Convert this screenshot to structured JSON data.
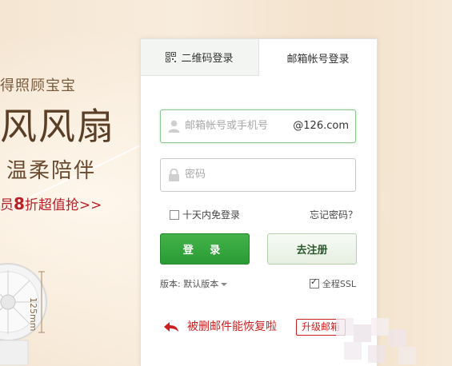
{
  "promo": {
    "line1": "得照顾宝宝",
    "line2": "风风扇",
    "line3": "温柔陪伴",
    "line4_pre": "员",
    "line4_hl": "8",
    "line4_post": "折超值抢>>",
    "dimension": "125mm"
  },
  "tabs": {
    "qr_label": "二维码登录",
    "email_label": "邮箱帐号登录"
  },
  "form": {
    "account_placeholder": "邮箱帐号或手机号",
    "domain_suffix": "@126.com",
    "password_placeholder": "密码",
    "remember_label": "十天内免登录",
    "forgot_label": "忘记密码？",
    "login_label": "登 录",
    "register_label": "去注册",
    "version_label": "版本: 默认版本",
    "ssl_label": "全程SSL",
    "ssl_checked": true,
    "remember_checked": false
  },
  "promo_bar": {
    "message": "被删邮件能恢复啦",
    "upgrade_label": "升级邮箱"
  },
  "colors": {
    "accent_green": "#2a9a34",
    "promo_red": "#cc1f1f",
    "background": "#f5e6d3"
  }
}
